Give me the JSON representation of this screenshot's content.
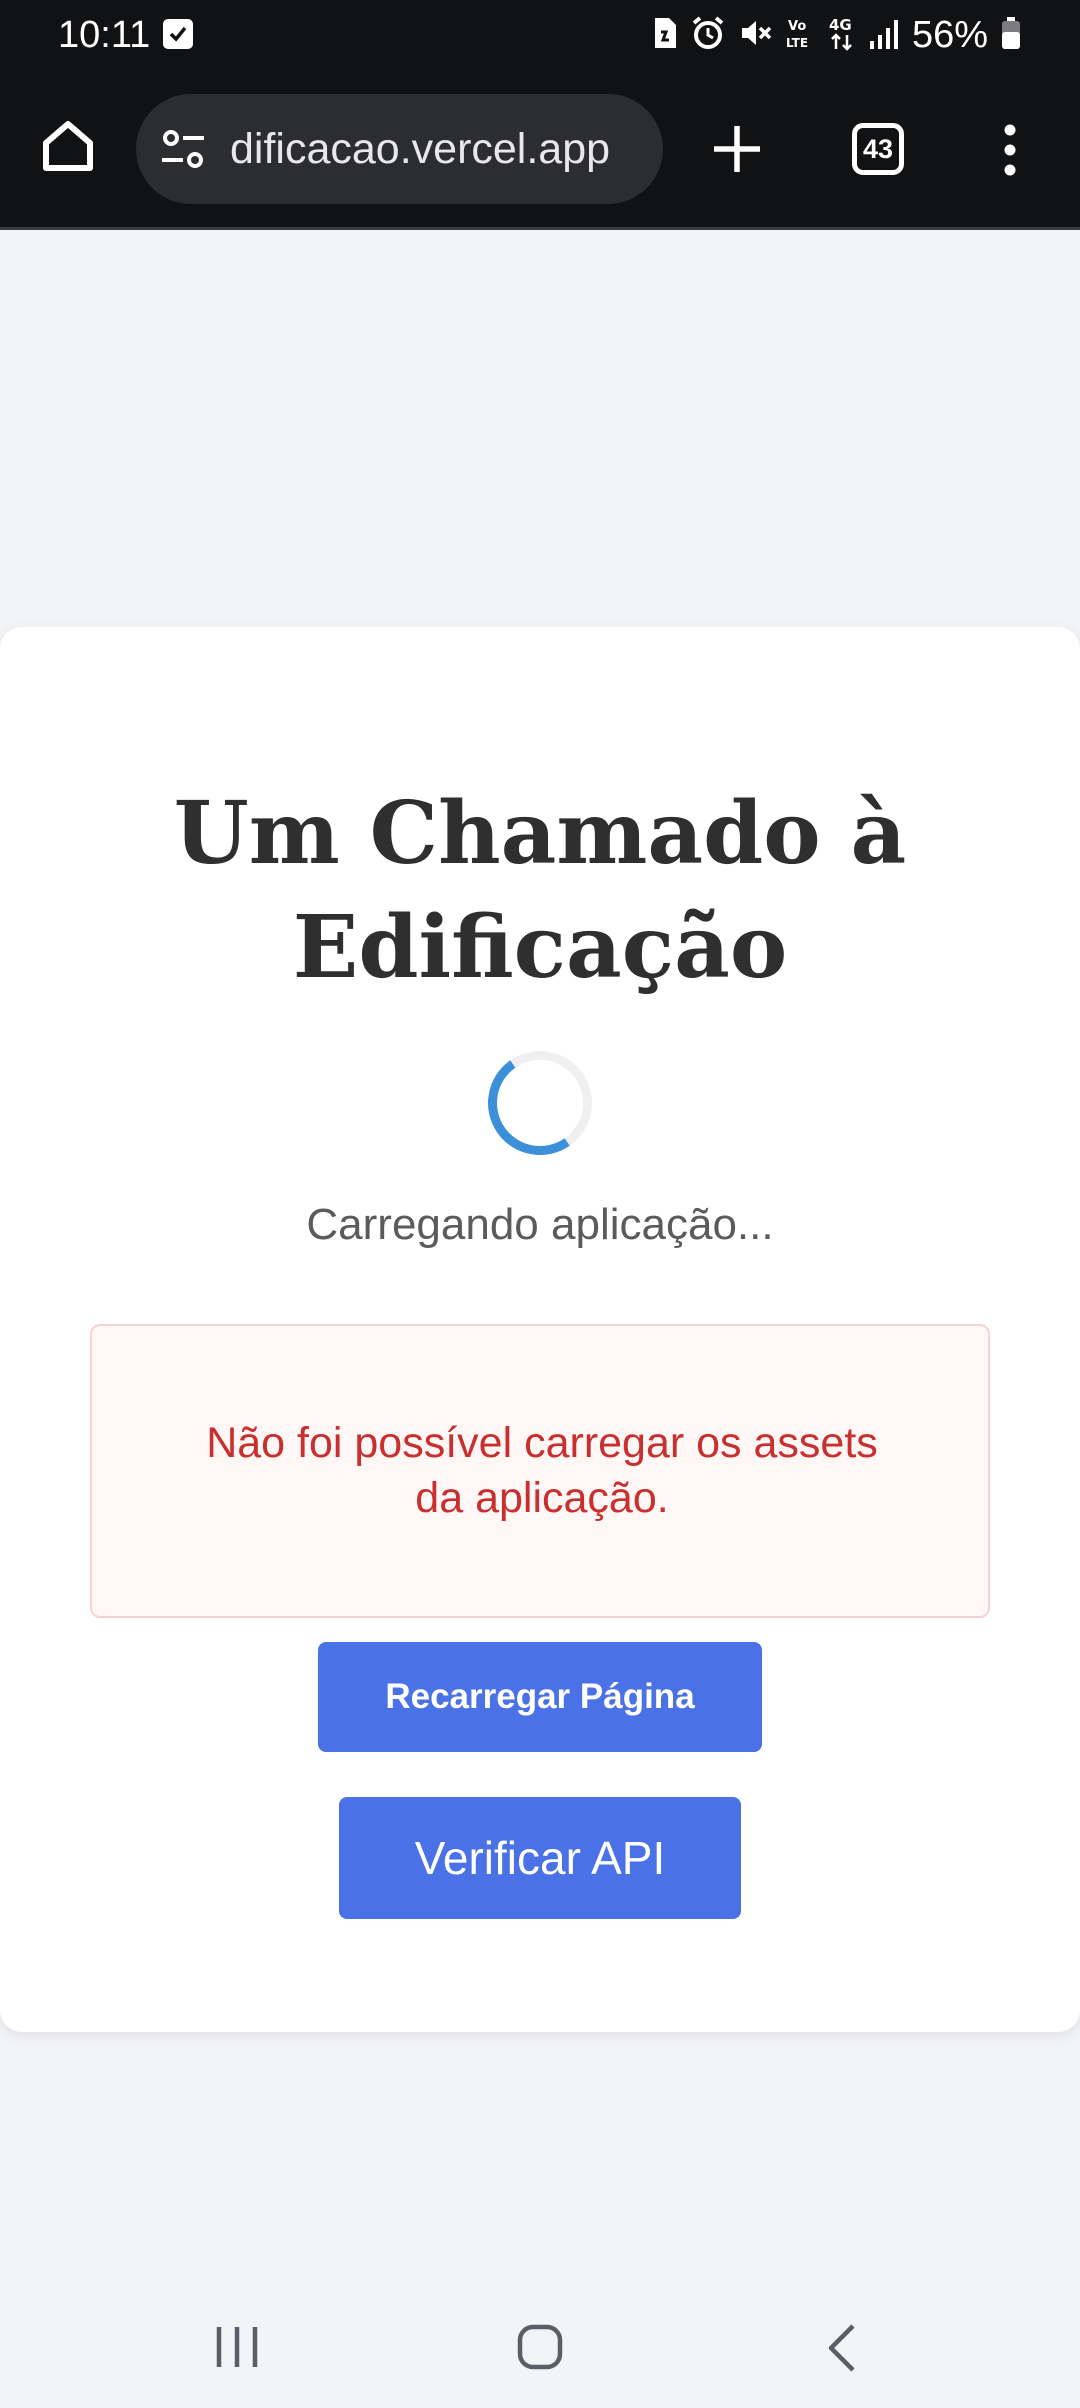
{
  "status_bar": {
    "time": "10:11",
    "battery": "56%",
    "icons": [
      "check-icon",
      "sim-icon",
      "alarm-icon",
      "mute-icon",
      "volte-icon",
      "4g-icon",
      "signal-icon",
      "battery-icon"
    ]
  },
  "browser": {
    "url": "dificacao.vercel.app",
    "tab_count": "43",
    "icons": [
      "home-icon",
      "site-settings-icon",
      "new-tab-icon",
      "tabs-icon",
      "menu-icon"
    ]
  },
  "page": {
    "title_line1": "Um Chamado à",
    "title_line2": "Edificação",
    "loading_text": "Carregando aplicação...",
    "error_line1": "Não foi possível carregar os assets",
    "error_line2": "da aplicação.",
    "reload_button": "Recarregar Página",
    "api_button": "Verificar API"
  },
  "colors": {
    "accent": "#4a72e6",
    "error": "#c8302f",
    "spinner": "#3c8fd9",
    "page_bg": "#f3f4f8",
    "bar_bg": "#111214"
  },
  "nav_bar": {
    "icons": [
      "recents-icon",
      "home-icon",
      "back-icon"
    ]
  }
}
